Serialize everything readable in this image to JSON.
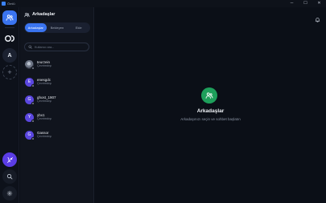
{
  "window": {
    "title": "Ömlü",
    "controls": {
      "minimize": "─",
      "maximize": "☐",
      "close": "✕"
    }
  },
  "rail": {
    "server_initial": "A",
    "add_label": "+",
    "icons": [
      "friends-icon",
      "app-logo-icon",
      "add-server-icon",
      "voice-off-icon",
      "search-icon",
      "settings-icon"
    ],
    "accent": "#3a74f0",
    "voice_color": "#5b3de6"
  },
  "panel": {
    "title": "Arkadaşlar",
    "tabs": [
      {
        "label": "Arkadaşlar",
        "active": true
      },
      {
        "label": "Bekleyen",
        "active": false
      },
      {
        "label": "Ekle",
        "active": false
      }
    ],
    "search_placeholder": "Kullanıcı ara...",
    "friends": [
      {
        "name": "teurzein",
        "status": "Çevrimdışı",
        "initial": "",
        "photo": true
      },
      {
        "name": "enesgdc",
        "status": "Çevrimdışı",
        "initial": "E",
        "photo": false
      },
      {
        "name": "ghost_1907",
        "status": "Çevrimdışı",
        "initial": "G",
        "photo": false
      },
      {
        "name": "ybx1",
        "status": "Çevrimdışı",
        "initial": "Y",
        "photo": false
      },
      {
        "name": "Gassor",
        "status": "Çevrimdışı",
        "initial": "G",
        "photo": false
      }
    ]
  },
  "main": {
    "empty_title": "Arkadaşlar",
    "empty_subtitle": "Arkadaşınızı seçin ve sohbet başlatın",
    "empty_color": "#1e9f5b"
  }
}
